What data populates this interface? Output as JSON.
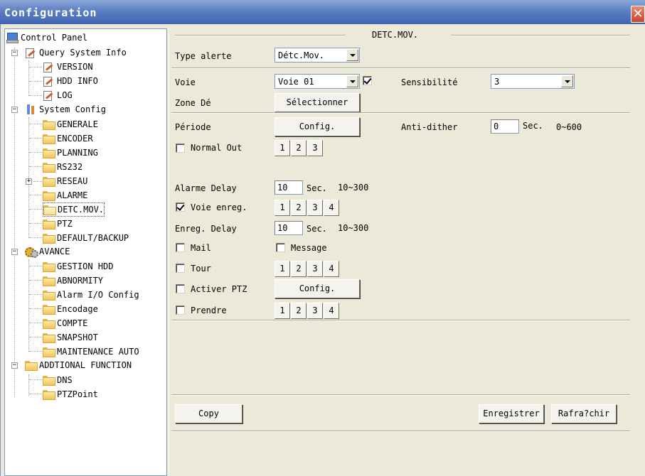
{
  "window": {
    "title": "Configuration"
  },
  "tree": {
    "control_panel": "Control Panel",
    "query_system_info": "Query System Info",
    "version": "VERSION",
    "hdd_info": "HDD INFO",
    "log": "LOG",
    "system_config": "System Config",
    "generale": "GENERALE",
    "encoder": "ENCODER",
    "planning": "PLANNING",
    "rs232": "RS232",
    "reseau": "RESEAU",
    "alarme": "ALARME",
    "detc_mov": "DETC.MOV.",
    "ptz": "PTZ",
    "default_backup": "DEFAULT/BACKUP",
    "avance": "AVANCE",
    "gestion_hdd": "GESTION HDD",
    "abnormity": "ABNORMITY",
    "alarm_io": "Alarm I/O Config",
    "encodage": "Encodage",
    "compte": "COMPTE",
    "snapshot": "SNAPSHOT",
    "maintenance_auto": "MAINTENANCE AUTO",
    "addtional_function": "ADDTIONAL FUNCTION",
    "dns": "DNS",
    "ptzpoint": "PTZPoint"
  },
  "form": {
    "section_title": "DETC.MOV.",
    "type_alerte_label": "Type alerte",
    "type_alerte_value": "Détc.Mov.",
    "voie_label": "Voie",
    "voie_value": "Voie 01",
    "sensibilite_label": "Sensibilité",
    "sensibilite_value": "3",
    "zone_label": "Zone Dé",
    "selectionner": "Sélectionner",
    "periode_label": "Période",
    "config_label": "Config.",
    "anti_dither_label": "Anti-dither",
    "anti_dither_value": "0",
    "sec": "Sec.",
    "anti_dither_range": "0~600",
    "normal_out_label": "Normal Out",
    "normal_out_buttons": [
      "1",
      "2",
      "3"
    ],
    "alarme_delay_label": "Alarme Delay",
    "alarme_delay_value": "10",
    "alarme_delay_range": "10~300",
    "voie_enreg_label": "Voie enreg.",
    "voie_enreg_buttons": [
      "1",
      "2",
      "3",
      "4"
    ],
    "enreg_delay_label": "Enreg. Delay",
    "enreg_delay_value": "10",
    "enreg_delay_range": "10~300",
    "mail_label": "Mail",
    "message_label": "Message",
    "tour_label": "Tour",
    "tour_buttons": [
      "1",
      "2",
      "3",
      "4"
    ],
    "activer_ptz_label": "Activer PTZ",
    "activer_ptz_config": "Config.",
    "prendre_label": "Prendre",
    "prendre_buttons": [
      "1",
      "2",
      "3",
      "4"
    ],
    "copy": "Copy",
    "enregistrer": "Enregistrer",
    "rafraichir": "Rafra?chir"
  }
}
